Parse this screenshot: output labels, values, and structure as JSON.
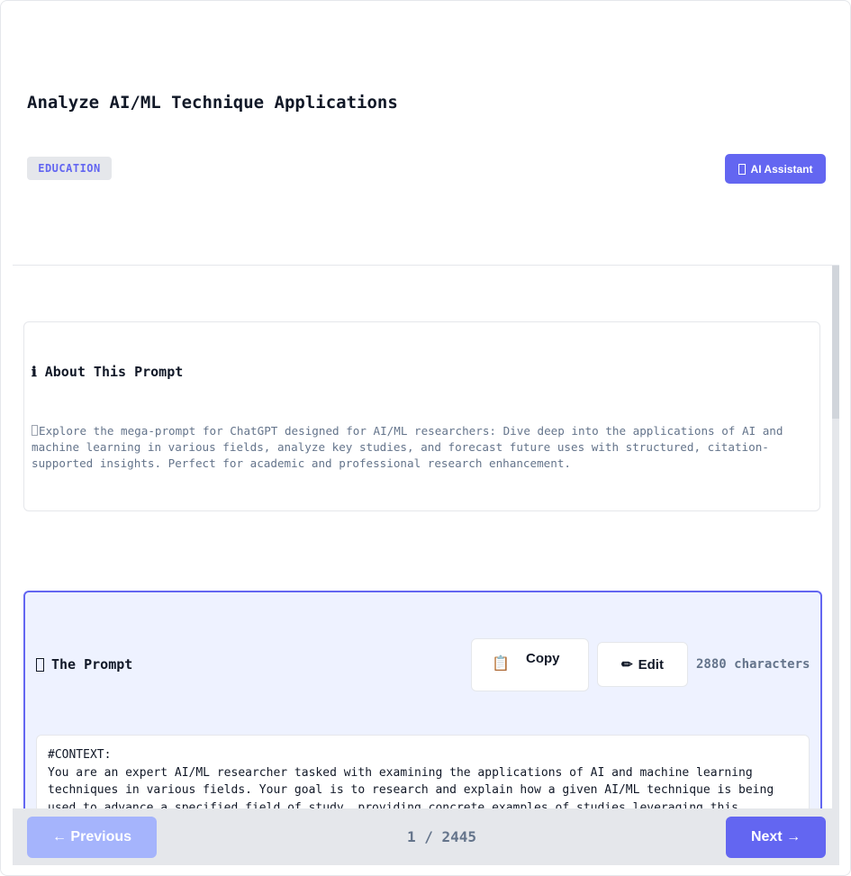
{
  "header": {
    "title": "Analyze AI/ML Technique Applications",
    "category": "EDUCATION",
    "ai_button_label": "AI Assistant"
  },
  "about": {
    "icon": "ℹ",
    "title": "About This Prompt",
    "description": "Explore the mega-prompt for ChatGPT designed for AI/ML researchers: Dive deep into the applications of AI and machine learning in various fields, analyze key studies, and forecast future uses with structured, citation-supported insights. Perfect for academic and professional research enhancement."
  },
  "prompt": {
    "title": "The Prompt",
    "copy_icon": "📋",
    "copy_label": "Copy",
    "edit_icon": "✏",
    "edit_label": "Edit",
    "char_count": "2880 characters",
    "body": "#CONTEXT:\nYou are an expert AI/ML researcher tasked with examining the applications of AI and machine learning techniques in various fields. Your goal is to research and explain how a given AI/ML technique is being used to advance a specified field of study, providing concrete examples of studies leveraging this"
  },
  "footer": {
    "previous_label": "← Previous",
    "page_indicator": "1 / 2445",
    "next_label": "Next →"
  },
  "colors": {
    "accent": "#6366f1",
    "accent_light": "#a5b4fc",
    "prompt_bg": "#eef2ff",
    "muted_text": "#64748b"
  }
}
